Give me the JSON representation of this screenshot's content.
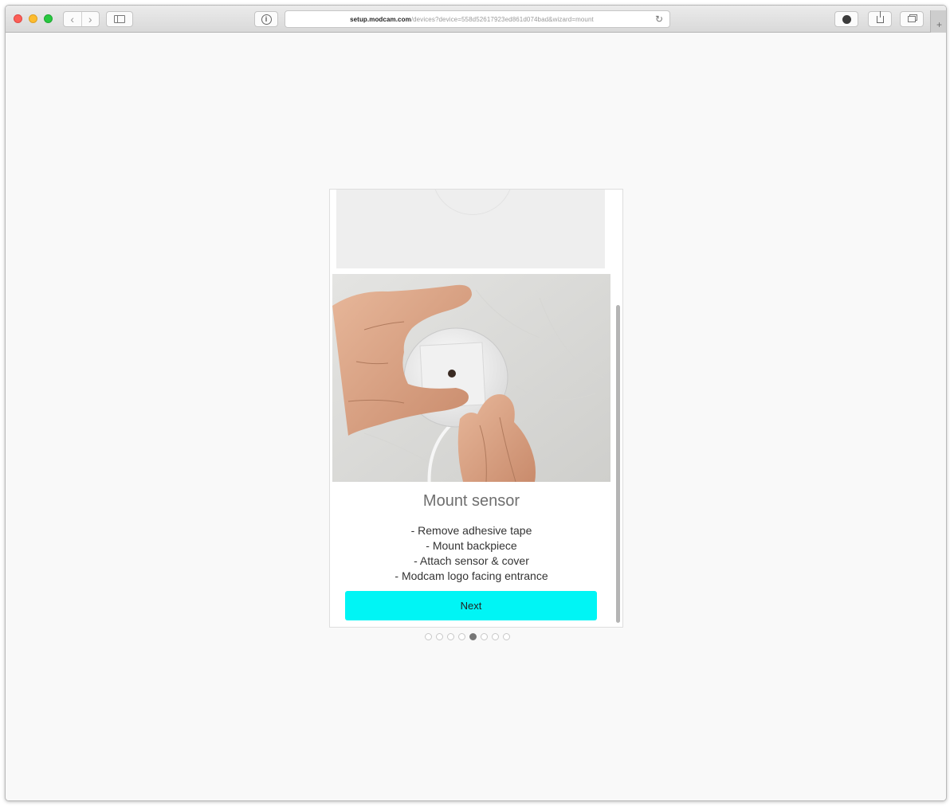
{
  "browser": {
    "url_host": "setup.modcam.com",
    "url_path": "/devices?device=558d52617923ed861d074bad&wizard=mount"
  },
  "step": {
    "title": "Mount sensor",
    "instructions": [
      "- Remove adhesive tape",
      "- Mount backpiece",
      "- Attach sensor & cover",
      "- Modcam logo facing entrance"
    ],
    "next_label": "Next"
  },
  "pagination": {
    "total": 8,
    "active_index": 4
  },
  "colors": {
    "accent": "#00f5f5",
    "page_bg": "#f9f9f9",
    "title": "#6f6f6f"
  },
  "icons": {
    "info": "info-icon",
    "reload": "reload-icon",
    "share": "share-icon",
    "extension": "extension-icon",
    "tabs": "tabs-icon",
    "sidebar": "sidebar-icon"
  }
}
